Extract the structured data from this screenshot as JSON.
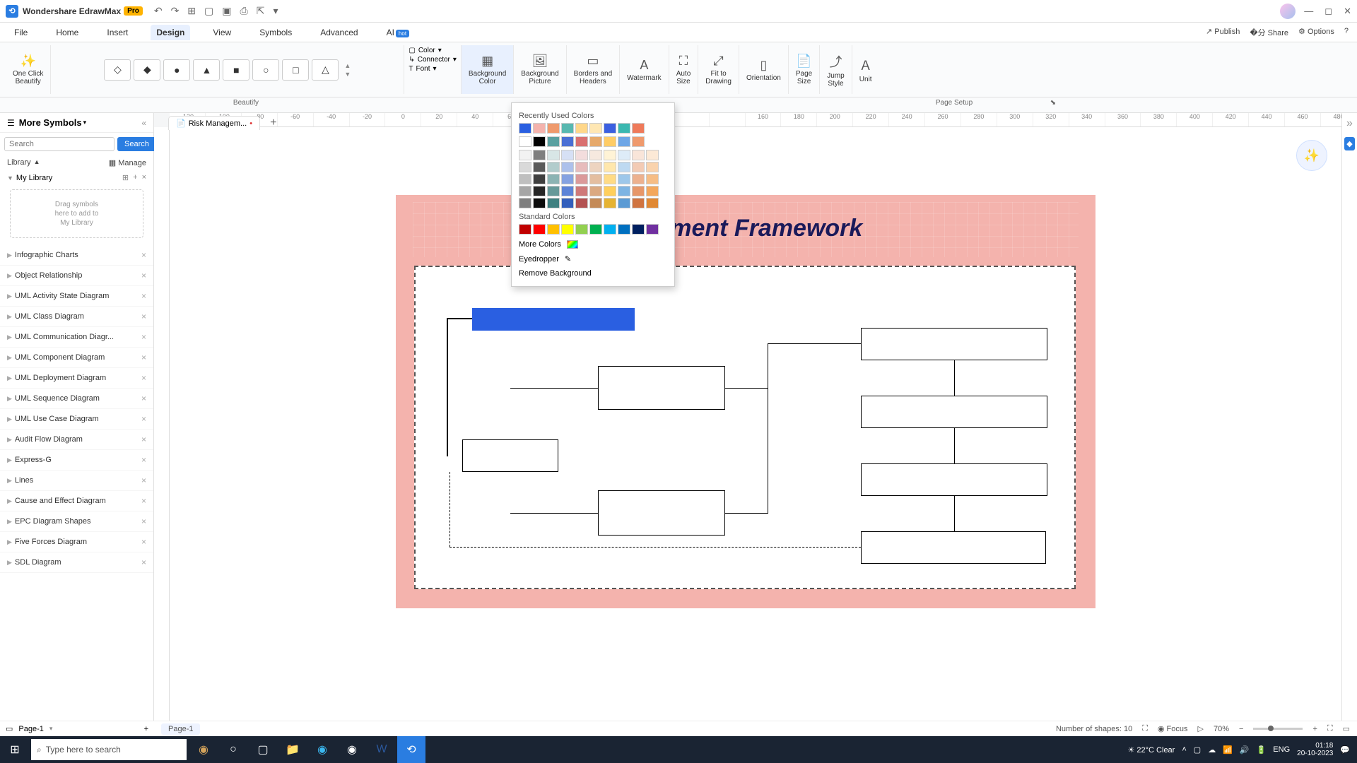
{
  "app": {
    "name": "Wondershare EdrawMax",
    "pro": "Pro"
  },
  "menu": {
    "items": [
      "File",
      "Home",
      "Insert",
      "Design",
      "View",
      "Symbols",
      "Advanced"
    ],
    "active": "Design",
    "ai": "AI",
    "hot": "hot",
    "right": {
      "publish": "Publish",
      "share": "Share",
      "options": "Options"
    }
  },
  "ribbon": {
    "oneclick": "One Click\nBeautify",
    "stylegroup": "Beautify",
    "color": "Color",
    "connector": "Connector",
    "font": "Font",
    "bgcolor": "Background\nColor",
    "bgpicture": "Background\nPicture",
    "borders": "Borders and\nHeaders",
    "watermark": "Watermark",
    "autosize": "Auto\nSize",
    "fit": "Fit to\nDrawing",
    "orientation": "Orientation",
    "pagesize": "Page\nSize",
    "jump": "Jump\nStyle",
    "unit": "Unit",
    "pagesetup": "Page Setup"
  },
  "sidebar": {
    "title": "More Symbols",
    "search_placeholder": "Search",
    "search_btn": "Search",
    "library": "Library",
    "manage": "Manage",
    "mylib": "My Library",
    "dropzone": "Drag symbols\nhere to add to\nMy Library",
    "categories": [
      "Infographic Charts",
      "Object Relationship",
      "UML Activity State Diagram",
      "UML Class Diagram",
      "UML Communication Diagr...",
      "UML Component Diagram",
      "UML Deployment Diagram",
      "UML Sequence Diagram",
      "UML Use Case Diagram",
      "Audit Flow Diagram",
      "Express-G",
      "Lines",
      "Cause and Effect Diagram",
      "EPC Diagram Shapes",
      "Five Forces Diagram",
      "SDL Diagram"
    ]
  },
  "doc": {
    "tab": "Risk Managem...",
    "title_visible": "agement Framework"
  },
  "ruler_ticks": [
    "-120",
    "-100",
    "-80",
    "-60",
    "-40",
    "-20",
    "0",
    "20",
    "40",
    "60",
    "",
    "",
    "",
    "",
    "",
    "",
    "160",
    "180",
    "200",
    "220",
    "240",
    "260",
    "280",
    "300",
    "320",
    "340",
    "360",
    "380",
    "400",
    "420",
    "440",
    "460",
    "480"
  ],
  "colormenu": {
    "recent_label": "Recently Used Colors",
    "standard_label": "Standard Colors",
    "more": "More Colors",
    "eyedropper": "Eyedropper",
    "remove": "Remove Background",
    "recent": [
      "#2a5fe1",
      "#f4b3ad",
      "#ef9a6d",
      "#58b8b0",
      "#ffd78a",
      "#ffe7b3",
      "#3b5fe0",
      "#3bb8b0",
      "#ef7a5a"
    ],
    "theme_row1": [
      "#ffffff",
      "#000000",
      "#5aa0a0",
      "#4a6fd4",
      "#d97070",
      "#e6a96b",
      "#ffcc66",
      "#6ea6e6",
      "#ef9a6d"
    ],
    "theme_grid": [
      "#f2f2f2",
      "#7f7f7f",
      "#d8e6e6",
      "#d6e0f5",
      "#f3dddd",
      "#f6e9df",
      "#fff3d6",
      "#deecf8",
      "#f9e5d9",
      "#fce9d6",
      "#d9d9d9",
      "#595959",
      "#b2cccc",
      "#adc1eb",
      "#e7bcbc",
      "#edd4c0",
      "#ffe7ad",
      "#bed9f1",
      "#f3cbb4",
      "#f9d3ad",
      "#bfbfbf",
      "#3f3f3f",
      "#8cb3b3",
      "#85a2e1",
      "#db9a9a",
      "#e4bea0",
      "#ffdb85",
      "#9dc7ea",
      "#edb18e",
      "#f6bd85",
      "#a6a6a6",
      "#262626",
      "#669999",
      "#5c83d7",
      "#cf7979",
      "#dba981",
      "#ffcf5c",
      "#7db4e3",
      "#e79769",
      "#f3a75c",
      "#7f7f7f",
      "#0c0c0c",
      "#3f8080",
      "#335fbc",
      "#b35252",
      "#c48a57",
      "#e6b333",
      "#5c9bd4",
      "#d07440",
      "#e08833"
    ],
    "standard": [
      "#c00000",
      "#ff0000",
      "#ffc000",
      "#ffff00",
      "#92d050",
      "#00b050",
      "#00b0f0",
      "#0070c0",
      "#002060",
      "#7030a0"
    ]
  },
  "bottombar_colors": [
    "#fff",
    "#c00",
    "#e06",
    "#f39",
    "#f9c",
    "#096",
    "#0cc",
    "#6cc",
    "#9dd",
    "#cee",
    "#f60",
    "#f90",
    "#fc0",
    "#fd6",
    "#090",
    "#0c6",
    "#6d9",
    "#9ec",
    "#cf9",
    "#69c",
    "#fc9",
    "#36c",
    "#69f",
    "#9cf",
    "#63c",
    "#96f",
    "#c9f",
    "#906",
    "#c39",
    "#c00",
    "#f66",
    "#630",
    "#963",
    "#c96",
    "#dba",
    "#6cf",
    "#9df",
    "#cef",
    "#333",
    "#666",
    "#999",
    "#ccc",
    "#000",
    "#333",
    "#666",
    "#999",
    "#ccc",
    "#eee"
  ],
  "status": {
    "page": "Page-1",
    "page_bottom": "Page-1",
    "shapes": "Number of shapes: 10",
    "focus": "Focus",
    "zoom": "70%"
  },
  "taskbar": {
    "search": "Type here to search",
    "weather": "22°C  Clear",
    "lang": "ENG",
    "time": "01:18",
    "date": "20-10-2023"
  }
}
